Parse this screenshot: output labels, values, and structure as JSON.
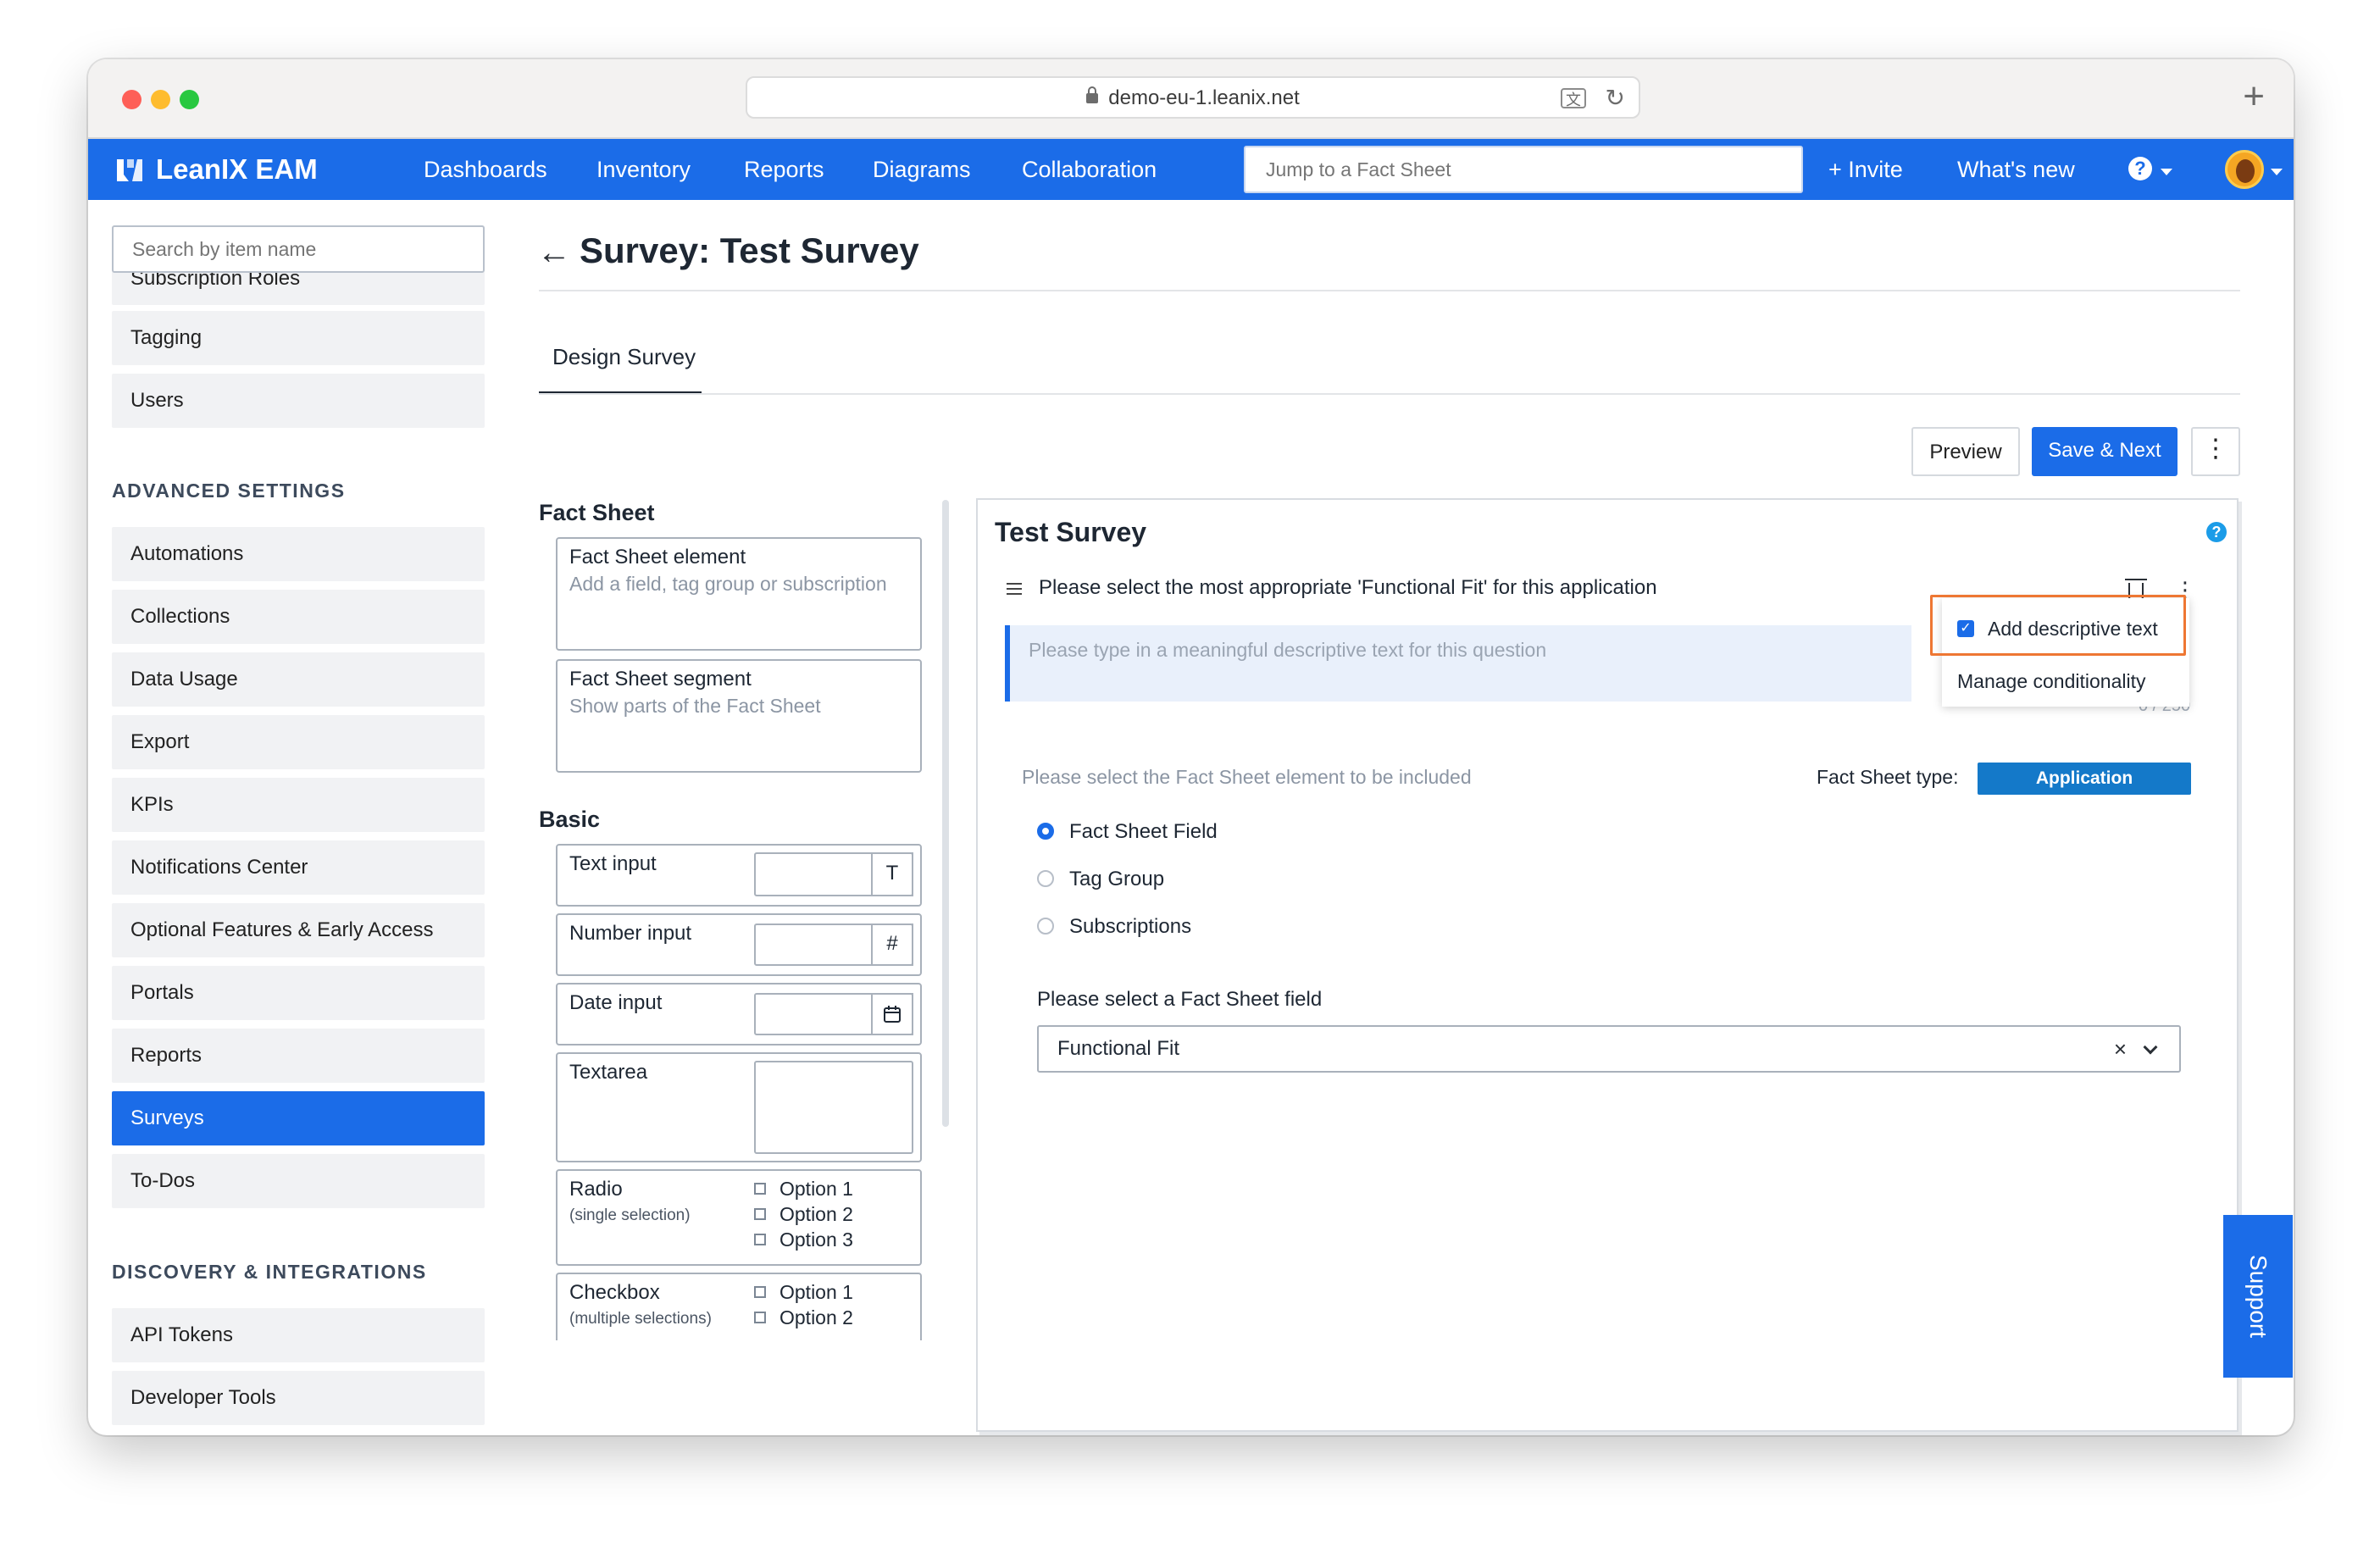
{
  "browser": {
    "url": "demo-eu-1.leanix.net"
  },
  "nav": {
    "brand": "LeanIX EAM",
    "items": [
      "Dashboards",
      "Inventory",
      "Reports",
      "Diagrams",
      "Collaboration"
    ],
    "jump_placeholder": "Jump to a Fact Sheet",
    "invite": "+ Invite",
    "whats_new": "What's new"
  },
  "sidebar": {
    "search_placeholder": "Search by item name",
    "clipped_item": "Subscription Roles",
    "top_items": [
      "Tagging",
      "Users"
    ],
    "advanced_heading": "ADVANCED SETTINGS",
    "advanced_items": [
      "Automations",
      "Collections",
      "Data Usage",
      "Export",
      "KPIs",
      "Notifications Center",
      "Optional Features & Early Access",
      "Portals",
      "Reports",
      "Surveys",
      "To-Dos"
    ],
    "active_item": "Surveys",
    "discovery_heading": "DISCOVERY & INTEGRATIONS",
    "discovery_items": [
      "API Tokens",
      "Developer Tools"
    ]
  },
  "page": {
    "title": "Survey: Test Survey",
    "tab": "Design Survey",
    "preview_button": "Preview",
    "save_button": "Save & Next"
  },
  "palette": {
    "fact_sheet_heading": "Fact Sheet",
    "element": {
      "title": "Fact Sheet element",
      "subtitle": "Add a field, tag group or subscription"
    },
    "segment": {
      "title": "Fact Sheet segment",
      "subtitle": "Show parts of the Fact Sheet"
    },
    "basic_heading": "Basic",
    "text_input": {
      "label": "Text input",
      "suffix": "T"
    },
    "number_input": {
      "label": "Number input",
      "suffix": "#"
    },
    "date_input": {
      "label": "Date input"
    },
    "textarea": {
      "label": "Textarea"
    },
    "radio": {
      "label": "Radio",
      "hint": "(single selection)",
      "options": [
        "Option 1",
        "Option 2",
        "Option 3"
      ]
    },
    "checkbox": {
      "label": "Checkbox",
      "hint": "(multiple selections)",
      "options": [
        "Option 1",
        "Option 2"
      ]
    }
  },
  "survey": {
    "title": "Test Survey",
    "question": "Please select the most appropriate 'Functional Fit' for this application",
    "descriptive_placeholder": "Please type in a meaningful descriptive text for this question",
    "counter": "0 / 250",
    "menu": {
      "add_descriptive_text": "Add descriptive text",
      "manage_conditionality": "Manage conditionality"
    },
    "select_element_label": "Please select the Fact Sheet element to be included",
    "fact_sheet_type_label": "Fact Sheet type:",
    "fact_sheet_type_value": "Application",
    "element_options": [
      "Fact Sheet Field",
      "Tag Group",
      "Subscriptions"
    ],
    "selected_option": "Fact Sheet Field",
    "field_label": "Please select a Fact Sheet field",
    "field_value": "Functional Fit"
  },
  "support": "Support",
  "colors": {
    "brand_blue": "#1b6ce8",
    "badge_blue": "#1479c9",
    "highlight_orange": "#ee7733"
  }
}
